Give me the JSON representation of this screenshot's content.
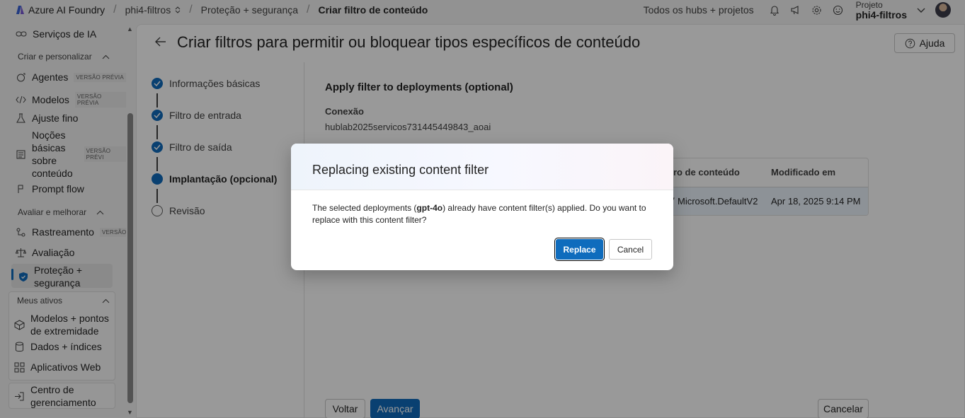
{
  "topbar": {
    "brand": "Azure AI Foundry",
    "crumbs": [
      "phi4-filtros",
      "Proteção + segurança",
      "Criar filtro de conteúdo"
    ],
    "hubs_link": "Todos os hubs + projetos",
    "project_label": "Projeto",
    "project_name": "phi4-filtros"
  },
  "sidebar": {
    "services": "Serviços de IA",
    "section_create": "Criar e personalizar",
    "agents": "Agentes",
    "agents_badge": "VERSÃO PRÉVIA",
    "models": "Modelos",
    "models_badge": "VERSÃO PRÉVIA",
    "finetune": "Ajuste fino",
    "basics_lines": [
      "Noções",
      "básicas",
      "sobre",
      "conteúdo"
    ],
    "basics_badge": "VERSÃO PRÉVI",
    "promptflow": "Prompt flow",
    "section_eval": "Avaliar e melhorar",
    "tracing": "Rastreamento",
    "tracing_badge": "VERSÃO",
    "evaluation": "Avaliação",
    "safety_lines": [
      "Proteção +",
      "segurança"
    ],
    "section_assets": "Meus ativos",
    "endpoints_lines": [
      "Modelos + pontos",
      "de extremidade"
    ],
    "data": "Dados + índices",
    "webapps": "Aplicativos Web",
    "mgmt_lines": [
      "Centro de",
      "gerenciamento"
    ]
  },
  "page": {
    "title": "Criar filtros para permitir ou bloquear tipos específicos de conteúdo",
    "help": "Ajuda"
  },
  "steps": [
    {
      "label": "Informações básicas",
      "state": "done"
    },
    {
      "label": "Filtro de entrada",
      "state": "done"
    },
    {
      "label": "Filtro de saída",
      "state": "done"
    },
    {
      "label": "Implantação (opcional)",
      "state": "current"
    },
    {
      "label": "Revisão",
      "state": "todo"
    }
  ],
  "content": {
    "title": "Apply filter to deployments (optional)",
    "connection_label": "Conexão",
    "connection_value": "hublab2025servicos731445449843_aoai",
    "table": {
      "headers": [
        "ltro de conteúdo",
        "Modificado em"
      ],
      "row": [
        "Microsoft.DefaultV2",
        "Apr 18, 2025 9:14 PM"
      ]
    }
  },
  "footer": {
    "back": "Voltar",
    "next": "Avançar",
    "cancel": "Cancelar"
  },
  "dialog": {
    "title": "Replacing existing content filter",
    "body_pre": "The selected deployments (",
    "body_bold": "gpt-4o",
    "body_post": ") already have content filter(s) applied. Do you want to replace with this content filter?",
    "replace": "Replace",
    "cancel": "Cancel"
  },
  "colors": {
    "accent": "#0f6cbd",
    "selected_row": "#ebf3fc",
    "overlay": "rgba(0,0,0,0.40)"
  }
}
